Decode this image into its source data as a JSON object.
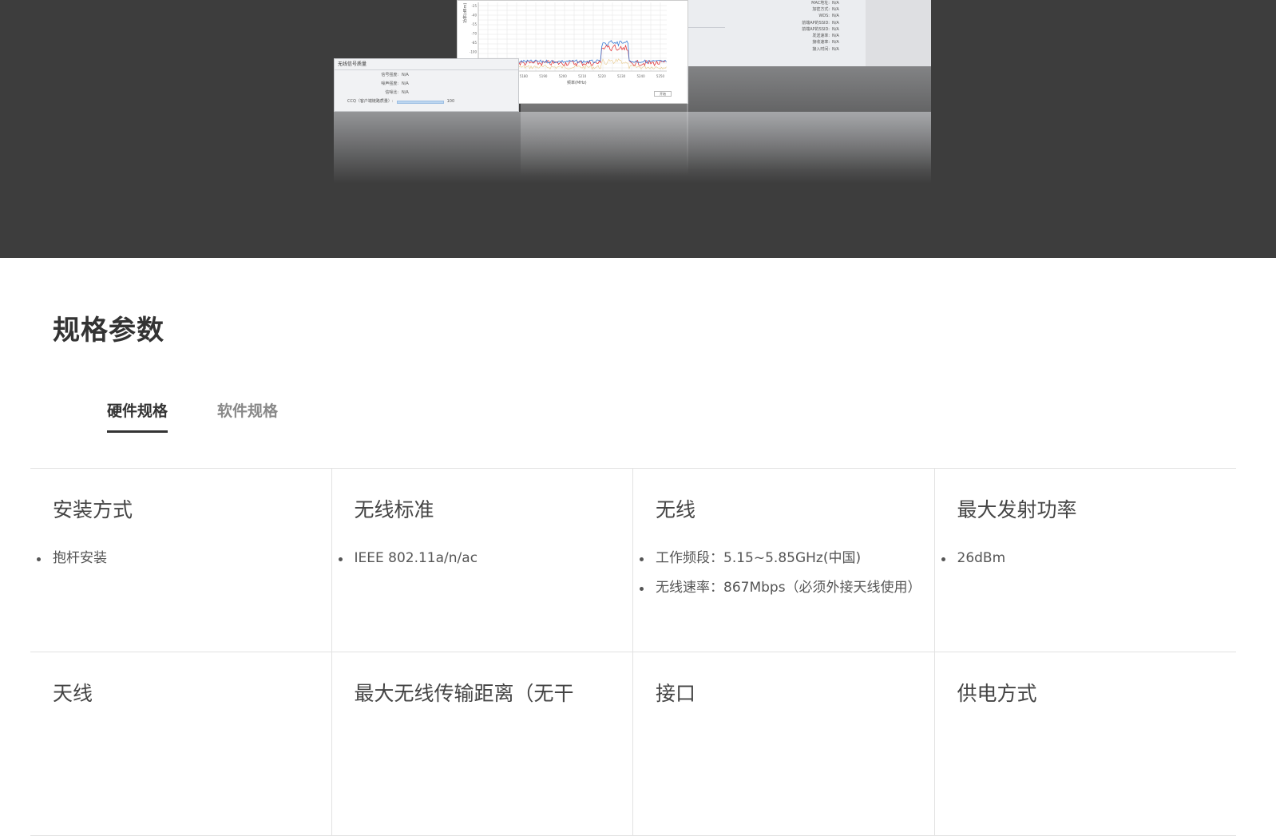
{
  "hero": {
    "right_panel": {
      "rows": [
        {
          "k": "MAC地址:",
          "v": "N/A"
        },
        {
          "k": "加密方式:",
          "v": "N/A"
        },
        {
          "k": "WDS:",
          "v": "N/A"
        },
        {
          "k": "前端AP的SSID:",
          "v": "N/A"
        },
        {
          "k": "前端AP的SSID:",
          "v": "N/A"
        },
        {
          "k": "发送速率:",
          "v": "N/A"
        },
        {
          "k": "接收速率:",
          "v": "N/A"
        },
        {
          "k": "接入时间:",
          "v": "N/A"
        }
      ]
    },
    "chart_panel": {
      "ylabel": "功率(dBm)",
      "xlabel": "频率(MHz)",
      "button": "开始",
      "yticks": [
        "-25",
        "-40",
        "-55",
        "-70",
        "-85",
        "-100"
      ],
      "xticks": [
        "5160",
        "5170",
        "5180",
        "5190",
        "5200",
        "5210",
        "5220",
        "5230",
        "5240",
        "5250"
      ]
    },
    "signal_panel": {
      "title": "无线信号质量",
      "rows": [
        {
          "k": "信号强度:",
          "v": "N/A"
        },
        {
          "k": "噪声强度:",
          "v": "N/A"
        },
        {
          "k": "信噪比:",
          "v": "N/A"
        }
      ],
      "ccq_label": "CCQ（客户端链路质量）:",
      "ccq_value": "100"
    }
  },
  "spec": {
    "title": "规格参数",
    "tabs": [
      {
        "label": "硬件规格",
        "active": true
      },
      {
        "label": "软件规格",
        "active": false
      }
    ],
    "rows": [
      [
        {
          "heading": "安装方式",
          "items": [
            "抱杆安装"
          ]
        },
        {
          "heading": "无线标准",
          "items": [
            "IEEE 802.11a/n/ac"
          ]
        },
        {
          "heading": "无线",
          "items": [
            "工作频段：5.15~5.85GHz(中国)",
            "无线速率：867Mbps（必须外接天线使用）"
          ]
        },
        {
          "heading": "最大发射功率",
          "items": [
            "26dBm"
          ]
        }
      ],
      [
        {
          "heading": "天线",
          "items": []
        },
        {
          "heading": "最大无线传输距离（无干",
          "items": []
        },
        {
          "heading": "接口",
          "items": []
        },
        {
          "heading": "供电方式",
          "items": []
        }
      ]
    ]
  },
  "colors": {
    "hero_bg": "#3d3d3d",
    "border": "#e2e2e2",
    "text": "#333333",
    "series_red": "#e0262a",
    "series_blue": "#3a7bd5"
  }
}
